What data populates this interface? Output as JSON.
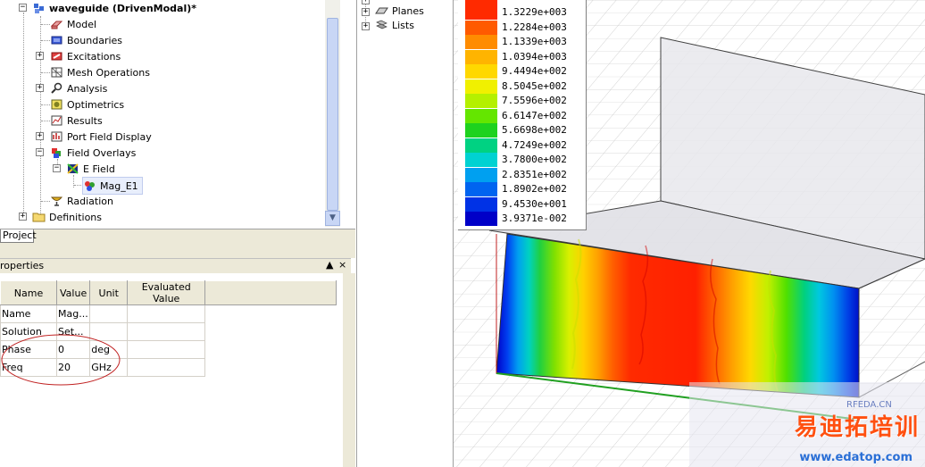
{
  "project_tree": {
    "root": "waveguide (DrivenModal)*",
    "items": [
      {
        "label": "Model",
        "icon": "model-icon"
      },
      {
        "label": "Boundaries",
        "icon": "boundaries-icon"
      },
      {
        "label": "Excitations",
        "icon": "excitations-icon"
      },
      {
        "label": "Mesh Operations",
        "icon": "mesh-icon"
      },
      {
        "label": "Analysis",
        "icon": "analysis-icon"
      },
      {
        "label": "Optimetrics",
        "icon": "optimetrics-icon"
      },
      {
        "label": "Results",
        "icon": "results-icon"
      },
      {
        "label": "Port Field Display",
        "icon": "port-field-icon"
      },
      {
        "label": "Field Overlays",
        "icon": "field-overlays-icon"
      },
      {
        "label": "E Field",
        "icon": "e-field-icon"
      },
      {
        "label": "Mag_E1",
        "icon": "mag-plot-icon"
      },
      {
        "label": "Radiation",
        "icon": "radiation-icon"
      },
      {
        "label": "Definitions",
        "icon": "folder-icon"
      }
    ],
    "tab": "Project"
  },
  "properties": {
    "title": "roperties",
    "columns": [
      "Name",
      "Value",
      "Unit",
      "Evaluated Value"
    ],
    "rows": [
      [
        "Name",
        "Mag...",
        "",
        ""
      ],
      [
        "Solution",
        "Set...",
        "",
        ""
      ],
      [
        "Phase",
        "0",
        "deg",
        ""
      ],
      [
        "Freq",
        "20",
        "GHz",
        ""
      ]
    ]
  },
  "middle_tree": {
    "items": [
      "Planes",
      "Lists"
    ]
  },
  "legend": {
    "values": [
      "1.3229e+003",
      "1.2284e+003",
      "1.1339e+003",
      "1.0394e+003",
      "9.4494e+002",
      "8.5045e+002",
      "7.5596e+002",
      "6.6147e+002",
      "5.6698e+002",
      "4.7249e+002",
      "3.7800e+002",
      "2.8351e+002",
      "1.8902e+002",
      "9.4530e+001",
      "3.9371e-002"
    ],
    "colors": [
      "#ff2a00",
      "#ff5a00",
      "#ff8c00",
      "#ffb400",
      "#ffd800",
      "#f0f000",
      "#b4f000",
      "#64e600",
      "#1ed21e",
      "#00d282",
      "#00d2d2",
      "#00a0f0",
      "#0064f0",
      "#0032e6",
      "#0000c8"
    ]
  },
  "watermark": {
    "cn_text": "易迪拓培训",
    "url": "www.edatop.com",
    "logo": "RFEDA.CN"
  }
}
